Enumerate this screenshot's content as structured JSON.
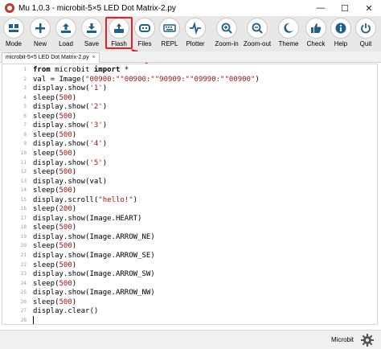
{
  "window": {
    "title": "Mu 1.0.3 - microbit-5×5 LED Dot Matrix-2.py",
    "minimize": "—",
    "maximize": "☐",
    "close": "✕"
  },
  "toolbar": {
    "mode": "Mode",
    "new": "New",
    "load": "Load",
    "save": "Save",
    "flash": "Flash",
    "files": "Files",
    "repl": "REPL",
    "plotter": "Plotter",
    "zoom_in": "Zoom-in",
    "zoom_out": "Zoom-out",
    "theme": "Theme",
    "check": "Check",
    "help": "Help",
    "quit": "Quit"
  },
  "tab": {
    "label": "microbit-5×5 LED Dot Matrix-2.py",
    "close": "×"
  },
  "editor": {
    "lines": [
      "from microbit import *",
      "val = Image(\"00900:\"\"00900:\"\"90909:\"\"09990:\"\"00900\")",
      "display.show('1')",
      "sleep(500)",
      "display.show('2')",
      "sleep(500)",
      "display.show('3')",
      "sleep(500)",
      "display.show('4')",
      "sleep(500)",
      "display.show('5')",
      "sleep(500)",
      "display.show(val)",
      "sleep(500)",
      "display.scroll(\"hello!\")",
      "sleep(200)",
      "display.show(Image.HEART)",
      "sleep(500)",
      "display.show(Image.ARROW_NE)",
      "sleep(500)",
      "display.show(Image.ARROW_SE)",
      "sleep(500)",
      "display.show(Image.ARROW_SW)",
      "sleep(500)",
      "display.show(Image.ARROW_NW)",
      "sleep(500)",
      "display.clear()"
    ],
    "line_numbers": [
      "1",
      "2",
      "3",
      "4",
      "5",
      "6",
      "7",
      "8",
      "9",
      "10",
      "11",
      "12",
      "13",
      "14",
      "15",
      "16",
      "17",
      "18",
      "19",
      "20",
      "21",
      "22",
      "23",
      "24",
      "25",
      "26",
      "27",
      "28"
    ]
  },
  "status": {
    "mode_label": "Microbit"
  },
  "colors": {
    "toolbar_bg": "#e8e8e8",
    "icon_blue": "#1f5f8b",
    "highlight_red": "#e02222",
    "string_red": "#a31515"
  },
  "icons": {
    "mode": "mode-icon",
    "new": "plus-icon",
    "load": "upload-icon",
    "save": "download-icon",
    "flash": "flash-icon",
    "files": "files-icon",
    "repl": "keyboard-icon",
    "plotter": "pulse-icon",
    "zoom_in": "zoom-in-icon",
    "zoom_out": "zoom-out-icon",
    "theme": "moon-icon",
    "check": "thumbs-up-icon",
    "help": "info-icon",
    "quit": "power-icon",
    "settings": "gear-icon"
  }
}
